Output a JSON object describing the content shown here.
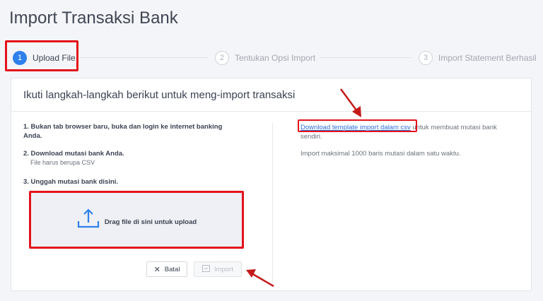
{
  "page": {
    "title": "Import Transaksi Bank"
  },
  "stepper": {
    "steps": [
      {
        "number": "1",
        "label": "Upload File"
      },
      {
        "number": "2",
        "label": "Tentukan Opsi Import"
      },
      {
        "number": "3",
        "label": "Import Statement Berhasil"
      }
    ]
  },
  "card": {
    "header": "Ikuti langkah-langkah berikut untuk meng-import transaksi",
    "instructions": {
      "step1": "1. Bukan tab browser baru, buka dan login ke internet banking Anda.",
      "step2": "2. Download mutasi bank Anda.",
      "step2_note": "File harus berupa CSV",
      "step3": "3. Unggah mutasi bank disini."
    },
    "dropzone": {
      "label": "Drag file di sini untuk upload"
    },
    "buttons": {
      "cancel": "Batal",
      "import": "Import"
    },
    "right": {
      "download_link": "Download template import dalam csv",
      "download_suffix": " untuk membuat mutasi bank sendiri.",
      "limit_note": "Import maksimal 1000 baris mutasi dalam satu waktu."
    }
  },
  "colors": {
    "accent": "#2f80ed",
    "highlight": "#e3121b",
    "link": "#2f6fd8"
  }
}
